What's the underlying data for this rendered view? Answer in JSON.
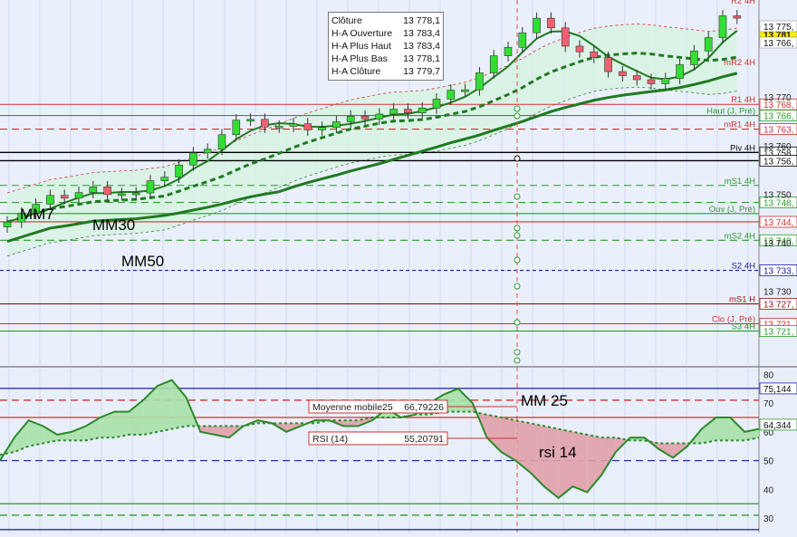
{
  "tooltip": {
    "rows": [
      {
        "label": "Clôture",
        "value": "13 778,1"
      },
      {
        "label": "H-A Ouverture",
        "value": "13 783,4"
      },
      {
        "label": "H-A Plus Haut",
        "value": "13 783,4"
      },
      {
        "label": "H-A Plus Bas",
        "value": "13 778,1"
      },
      {
        "label": "H-A Clôture",
        "value": "13 779,7"
      }
    ]
  },
  "annotations": {
    "mm7": "MM7",
    "mm30": "MM30",
    "mm50": "MM50",
    "mm25": "MM 25",
    "rsi14": "rsi 14"
  },
  "colors": {
    "bull": "#33dd33",
    "bear": "#f06070",
    "ma_dark": "#1f7a1f",
    "rsi_line": "#2a8a2a",
    "pivot_red": "#d23030",
    "pivot_green": "#2a9a2a",
    "price_badge": "#ffee00"
  },
  "chart_data": [
    {
      "type": "candlestick",
      "title": "",
      "yticks": [
        "13 770",
        "13 760",
        "13 750",
        "13 740",
        "13 730"
      ],
      "ylim": [
        13715,
        13790
      ],
      "last_price": "13 781,",
      "series": [
        {
          "name": "MM7",
          "kind": "line"
        },
        {
          "name": "MM30",
          "kind": "dashed line"
        },
        {
          "name": "MM50",
          "kind": "line"
        }
      ],
      "levels": [
        {
          "label": "R1 4H",
          "badge": "13 768,",
          "value": 13768.5,
          "color": "#d23030",
          "style": "solid"
        },
        {
          "label": "Haut (J, Pré)",
          "badge": "13 766,",
          "value": 13766.2,
          "color": "#2a9a2a",
          "style": "solid"
        },
        {
          "label": "mR1 4H",
          "badge": "13 763,",
          "value": 13763.4,
          "color": "#d23030",
          "style": "dashed"
        },
        {
          "label": "Piv 4H",
          "badge": "13 758,",
          "value": 13758.6,
          "color": "#000000",
          "style": "solid"
        },
        {
          "label": "",
          "badge": "13 756,",
          "value": 13756.9,
          "color": "#000000",
          "style": "solid"
        },
        {
          "label": "mS1 4H",
          "badge": "",
          "value": 13751.8,
          "color": "#2a9a2a",
          "style": "dashed"
        },
        {
          "label": "",
          "badge": "13 748,",
          "value": 13748.3,
          "color": "#2a9a2a",
          "style": "dashed"
        },
        {
          "label": "Ouv (J, Pré)",
          "badge": "",
          "value": 13746.0,
          "color": "#2a9a2a",
          "style": "solid"
        },
        {
          "label": "",
          "badge": "13 744,",
          "value": 13744.3,
          "color": "#d23030",
          "style": "solid"
        },
        {
          "label": "mS2 4H",
          "badge": "13 740,",
          "value": 13740.5,
          "color": "#2a9a2a",
          "style": "dashed"
        },
        {
          "label": "S2 4H",
          "badge": "13 733,",
          "value": 13734.3,
          "color": "#1a1aa0",
          "style": "dotted"
        },
        {
          "label": "mS1 H",
          "badge": "13 727,",
          "value": 13727.4,
          "color": "#a01010",
          "style": "solid"
        },
        {
          "label": "Clo (J, Pré)",
          "badge": "13 721,",
          "value": 13723.3,
          "color": "#d23030",
          "style": "solid"
        },
        {
          "label": "S3 4H",
          "badge": "13 721,",
          "value": 13721.8,
          "color": "#2a9a2a",
          "style": "solid"
        }
      ],
      "top_badges": [
        "13 781,",
        "13 775,",
        "13 766,"
      ],
      "top_labels": [
        "mR2 4H",
        "R2 4H"
      ]
    },
    {
      "type": "line",
      "title": "",
      "ylim": [
        25,
        82
      ],
      "yticks": [
        80,
        70,
        60,
        50,
        40,
        30
      ],
      "series": [
        {
          "name": "Moyenne mobile25",
          "value": "66,79226"
        },
        {
          "name": "RSI (14)",
          "value": "55,20791"
        }
      ],
      "badges": [
        "75,144",
        "64,344"
      ],
      "rsi": [
        50,
        58,
        64,
        62,
        59,
        60,
        62,
        65,
        67,
        67,
        71,
        76,
        78,
        72,
        60,
        59,
        58,
        62,
        64,
        63,
        60,
        62,
        64,
        64,
        62,
        62,
        64,
        68,
        65,
        66,
        70,
        73,
        75,
        70,
        58,
        53,
        50,
        46,
        41,
        37,
        41,
        39,
        45,
        53,
        58,
        58,
        54,
        51,
        55,
        61,
        65,
        65,
        60,
        61
      ],
      "ma25": [
        52,
        53,
        55,
        56,
        57,
        57,
        57,
        58,
        58,
        59,
        59,
        60,
        61,
        62,
        62,
        62,
        62,
        62,
        63,
        63,
        63,
        63,
        63,
        64,
        64,
        64,
        65,
        65,
        65,
        66,
        66,
        67,
        67,
        67,
        66,
        65,
        64,
        63,
        62,
        61,
        60,
        59,
        58,
        58,
        57,
        57,
        56,
        56,
        56,
        56,
        57,
        57,
        57,
        58
      ]
    }
  ]
}
